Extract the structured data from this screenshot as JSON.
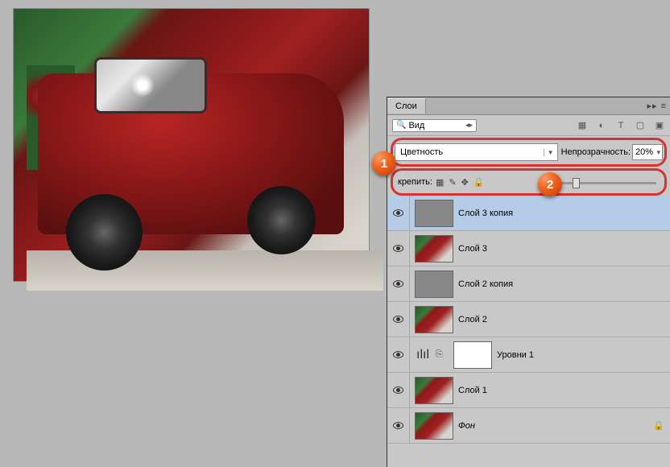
{
  "panel": {
    "tab_title": "Слои",
    "search_label": "Вид",
    "blend_mode": "Цветность",
    "opacity_label": "Непрозрачность:",
    "opacity_value": "20%",
    "lock_label": "крепить:",
    "markers": {
      "one": "1",
      "two": "2"
    }
  },
  "layers": [
    {
      "name": "Слой 3 копия",
      "thumb": "gray",
      "selected": true
    },
    {
      "name": "Слой 3",
      "thumb": "truck",
      "selected": false
    },
    {
      "name": "Слой 2 копия",
      "thumb": "gray",
      "selected": false
    },
    {
      "name": "Слой 2",
      "thumb": "truck",
      "selected": false
    },
    {
      "name": "Уровни 1",
      "thumb": "white",
      "selected": false,
      "adjustment": true
    },
    {
      "name": "Слой 1",
      "thumb": "truck",
      "selected": false
    },
    {
      "name": "Фон",
      "thumb": "truck",
      "selected": false,
      "locked": true
    }
  ]
}
